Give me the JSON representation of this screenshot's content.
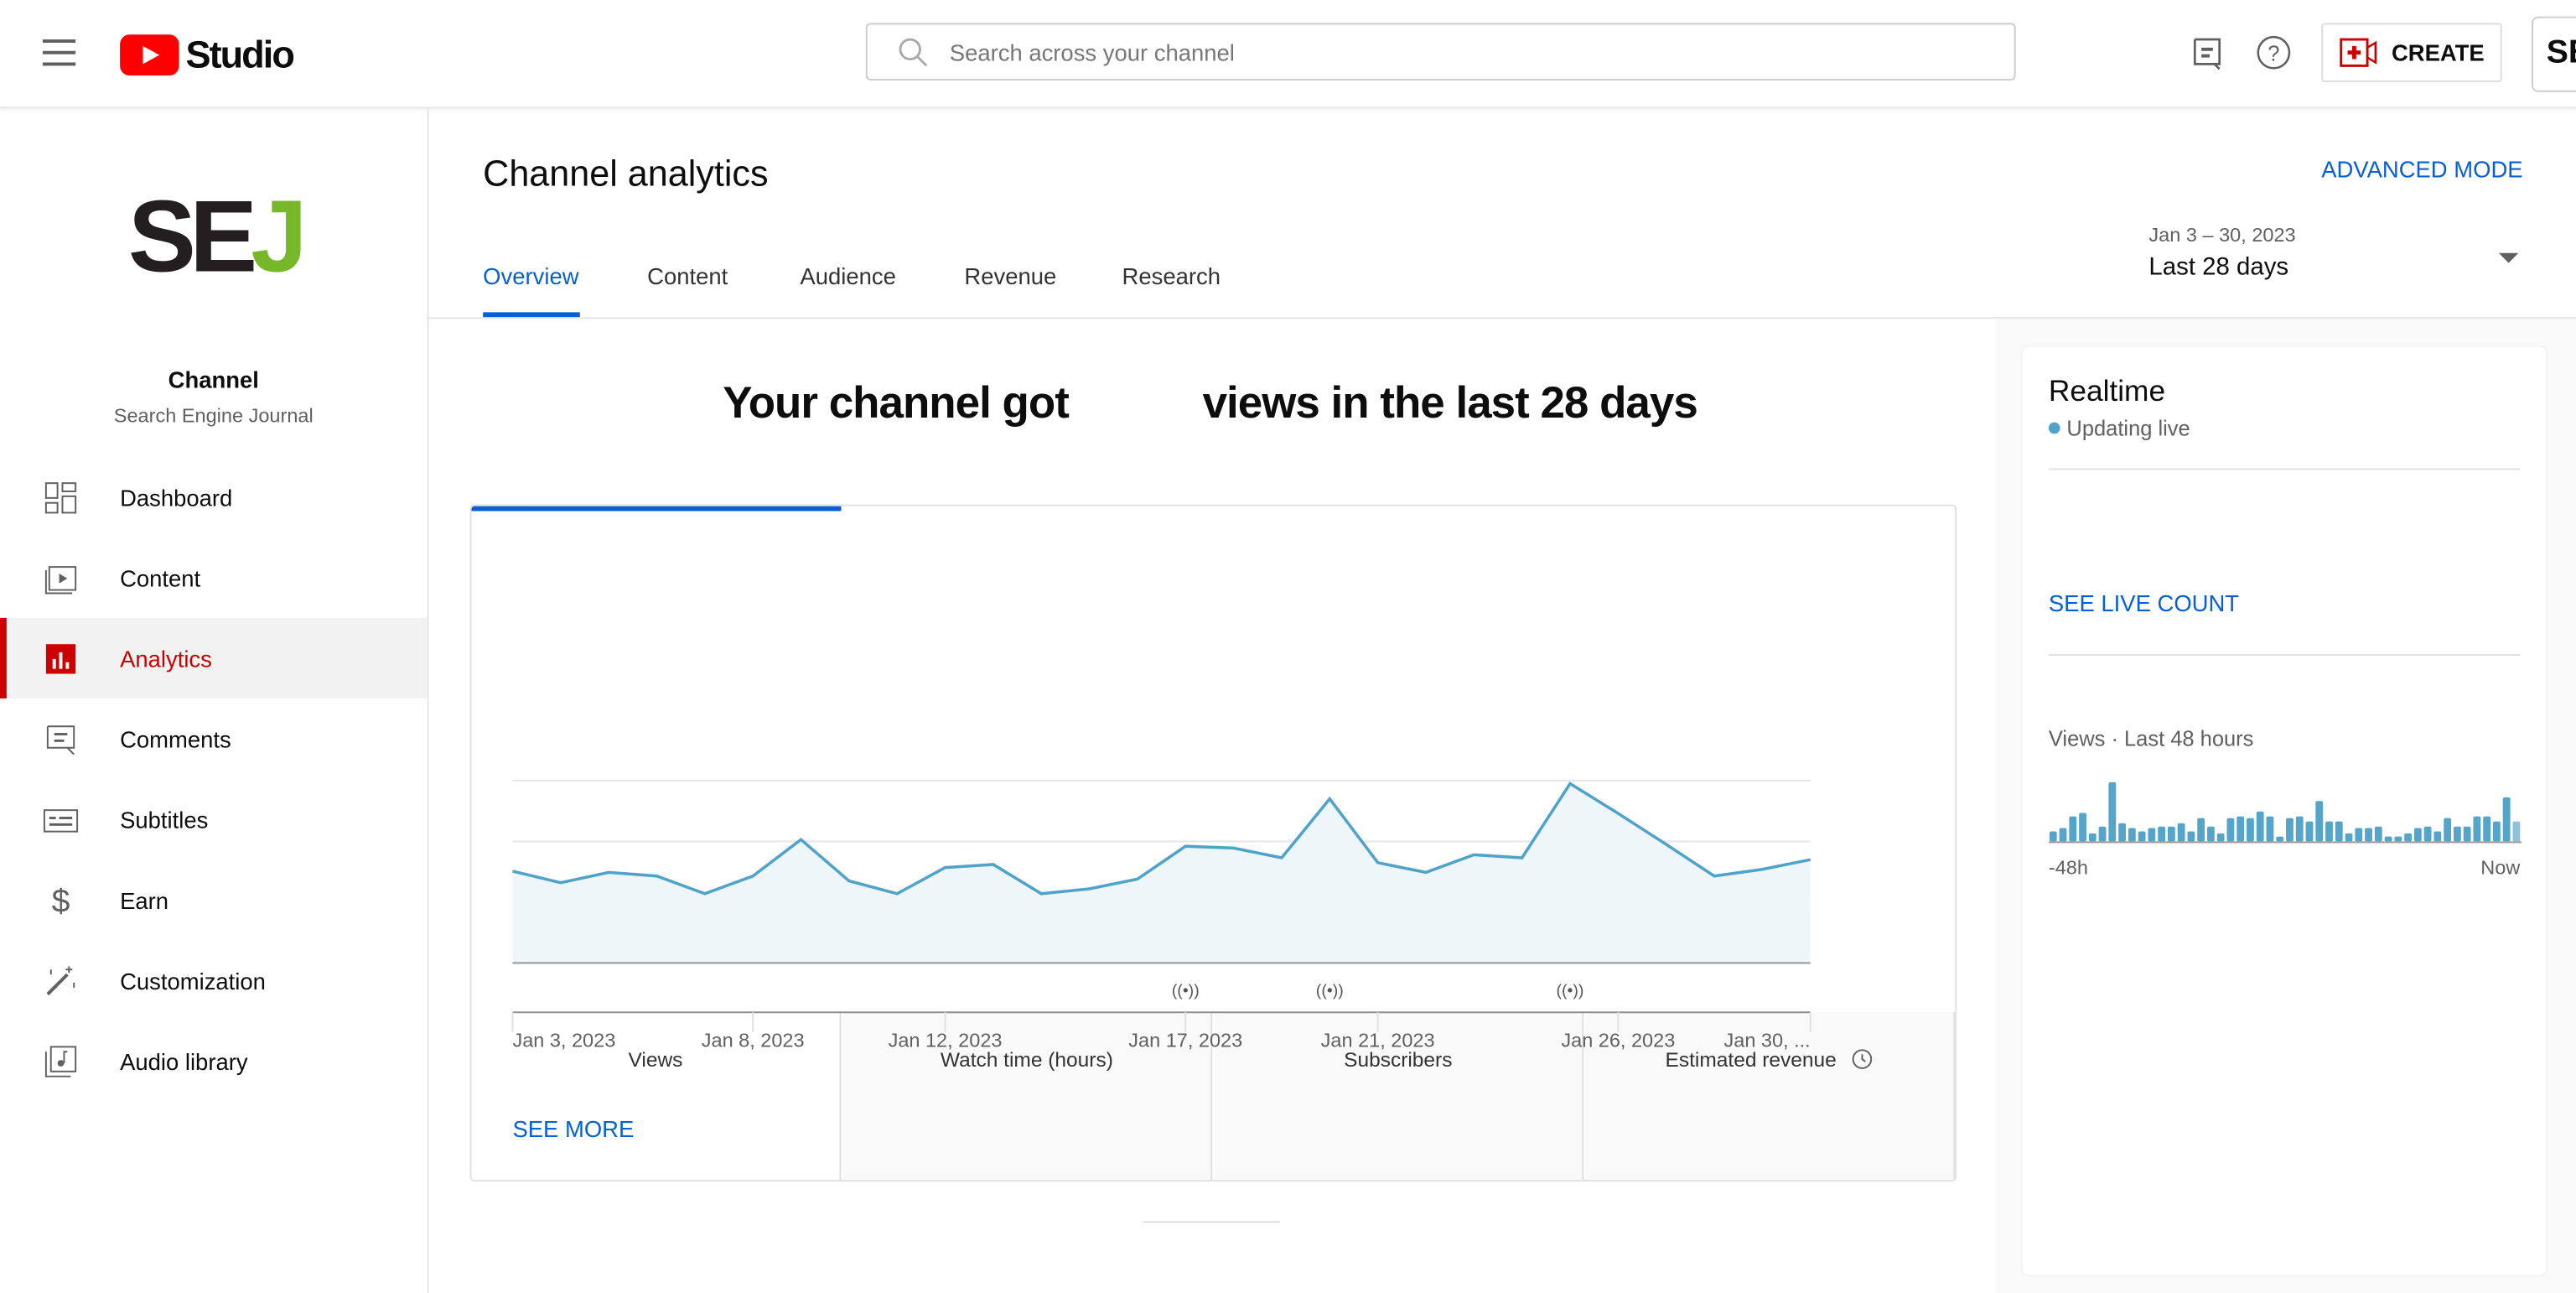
{
  "header": {
    "app_name": "Studio",
    "search_placeholder": "Search across your channel",
    "create_label": "CREATE",
    "account_initials": "SE"
  },
  "sidebar": {
    "channel_logo": "SEJ",
    "channel_label": "Channel",
    "channel_name": "Search Engine Journal",
    "items": [
      {
        "label": "Dashboard",
        "icon": "dashboard-icon"
      },
      {
        "label": "Content",
        "icon": "content-icon"
      },
      {
        "label": "Analytics",
        "icon": "analytics-icon",
        "active": true
      },
      {
        "label": "Comments",
        "icon": "comments-icon"
      },
      {
        "label": "Subtitles",
        "icon": "subtitles-icon"
      },
      {
        "label": "Earn",
        "icon": "dollar-icon"
      },
      {
        "label": "Customization",
        "icon": "wand-icon"
      },
      {
        "label": "Audio library",
        "icon": "audio-library-icon"
      }
    ]
  },
  "main": {
    "title": "Channel analytics",
    "advanced_mode": "ADVANCED MODE",
    "tabs": [
      "Overview",
      "Content",
      "Audience",
      "Revenue",
      "Research"
    ],
    "date_range": {
      "dates": "Jan 3 – 30, 2023",
      "label": "Last 28 days"
    },
    "headline_before": "Your channel got",
    "headline_after": "views in the last 28 days",
    "metric_tabs": [
      "Views",
      "Watch time (hours)",
      "Subscribers",
      "Estimated revenue"
    ],
    "see_more": "SEE MORE"
  },
  "realtime": {
    "title": "Realtime",
    "status": "Updating live",
    "see_live": "SEE LIVE COUNT",
    "chart_label": "Views · Last 48 hours",
    "start_label": "-48h",
    "end_label": "Now"
  },
  "colors": {
    "accent": "#065fd4",
    "line": "#4fa3cb",
    "brand_red": "#cc0000"
  },
  "chart_data": [
    {
      "type": "area",
      "x_tick_labels": [
        "Jan 3, 2023",
        "Jan 8, 2023",
        "Jan 12, 2023",
        "Jan 17, 2023",
        "Jan 21, 2023",
        "Jan 26, 2023",
        "Jan 30, ..."
      ],
      "x": [
        "Jan 3",
        "Jan 4",
        "Jan 5",
        "Jan 6",
        "Jan 7",
        "Jan 8",
        "Jan 9",
        "Jan 10",
        "Jan 11",
        "Jan 12",
        "Jan 13",
        "Jan 14",
        "Jan 15",
        "Jan 16",
        "Jan 17",
        "Jan 18",
        "Jan 19",
        "Jan 20",
        "Jan 21",
        "Jan 22",
        "Jan 23",
        "Jan 24",
        "Jan 25",
        "Jan 26",
        "Jan 27",
        "Jan 28",
        "Jan 29",
        "Jan 30"
      ],
      "values": [
        1.51,
        1.32,
        1.49,
        1.43,
        1.14,
        1.43,
        2.03,
        1.35,
        1.14,
        1.57,
        1.62,
        1.14,
        1.22,
        1.38,
        1.92,
        1.89,
        1.73,
        2.7,
        1.65,
        1.49,
        1.78,
        1.73,
        2.95,
        2.46,
        1.95,
        1.43,
        1.54,
        1.7
      ],
      "ylim": [
        0,
        3
      ],
      "grid": true,
      "y_tick_labels_hidden": true,
      "live_stream_markers": [
        "Jan 17",
        "Jan 20",
        "Jan 25"
      ]
    },
    {
      "type": "bar",
      "title": "Views · Last 48 hours",
      "values": [
        35,
        47,
        88,
        100,
        28,
        52,
        208,
        64,
        47,
        35,
        47,
        52,
        52,
        64,
        35,
        82,
        52,
        28,
        82,
        88,
        82,
        105,
        88,
        17,
        82,
        88,
        70,
        142,
        70,
        70,
        28,
        47,
        47,
        52,
        17,
        17,
        28,
        47,
        52,
        35,
        82,
        52,
        52,
        88,
        88,
        70,
        155,
        70
      ]
    }
  ]
}
